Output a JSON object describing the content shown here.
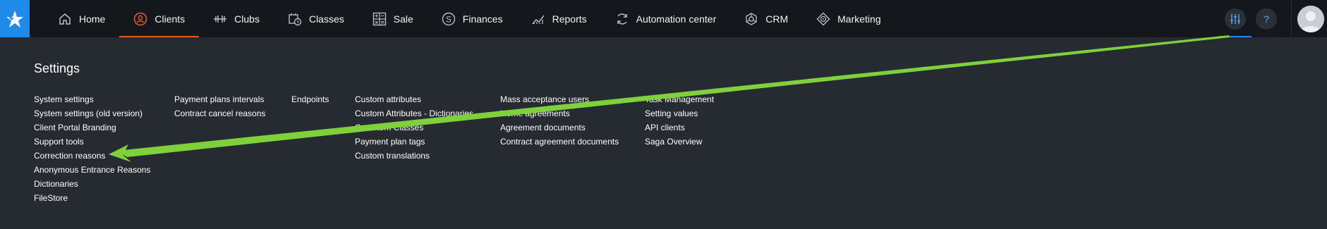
{
  "nav": {
    "items": [
      {
        "label": "Home",
        "icon": "home-icon"
      },
      {
        "label": "Clients",
        "icon": "clients-icon",
        "active": true
      },
      {
        "label": "Clubs",
        "icon": "dumbbell-icon"
      },
      {
        "label": "Classes",
        "icon": "calendar-clock-icon"
      },
      {
        "label": "Sale",
        "icon": "sale-grid-icon"
      },
      {
        "label": "Finances",
        "icon": "dollar-circle-icon"
      },
      {
        "label": "Reports",
        "icon": "chart-line-icon"
      },
      {
        "label": "Automation center",
        "icon": "sync-icon"
      },
      {
        "label": "CRM",
        "icon": "crm-network-icon"
      },
      {
        "label": "Marketing",
        "icon": "marketing-target-icon"
      }
    ]
  },
  "tools": {
    "settings_icon": "sliders-icon",
    "help_icon": "question-icon",
    "avatar_icon": "user-avatar-icon"
  },
  "settings": {
    "title": "Settings",
    "columns": [
      [
        "System settings",
        "System settings (old version)",
        "Client Portal Branding",
        "Support tools",
        "Correction reasons",
        "Anonymous Entrance Reasons",
        "Dictionaries",
        "FileStore"
      ],
      [
        "Payment plans intervals",
        "Contract cancel reasons"
      ],
      [
        "Endpoints"
      ],
      [
        "Custom attributes",
        "Custom Attributes - Dictionaries",
        "Cost Item Classes",
        "Payment plan tags",
        "Custom translations"
      ],
      [
        "Mass acceptance users",
        "Home agreements",
        "Agreement documents",
        "Contract agreement documents"
      ],
      [
        "Task Management",
        "Setting values",
        "API clients",
        "Saga Overview"
      ]
    ]
  },
  "colors": {
    "accent_active": "#e8572a",
    "brand": "#1f8ae8",
    "annotation_arrow": "#7ed13a"
  }
}
